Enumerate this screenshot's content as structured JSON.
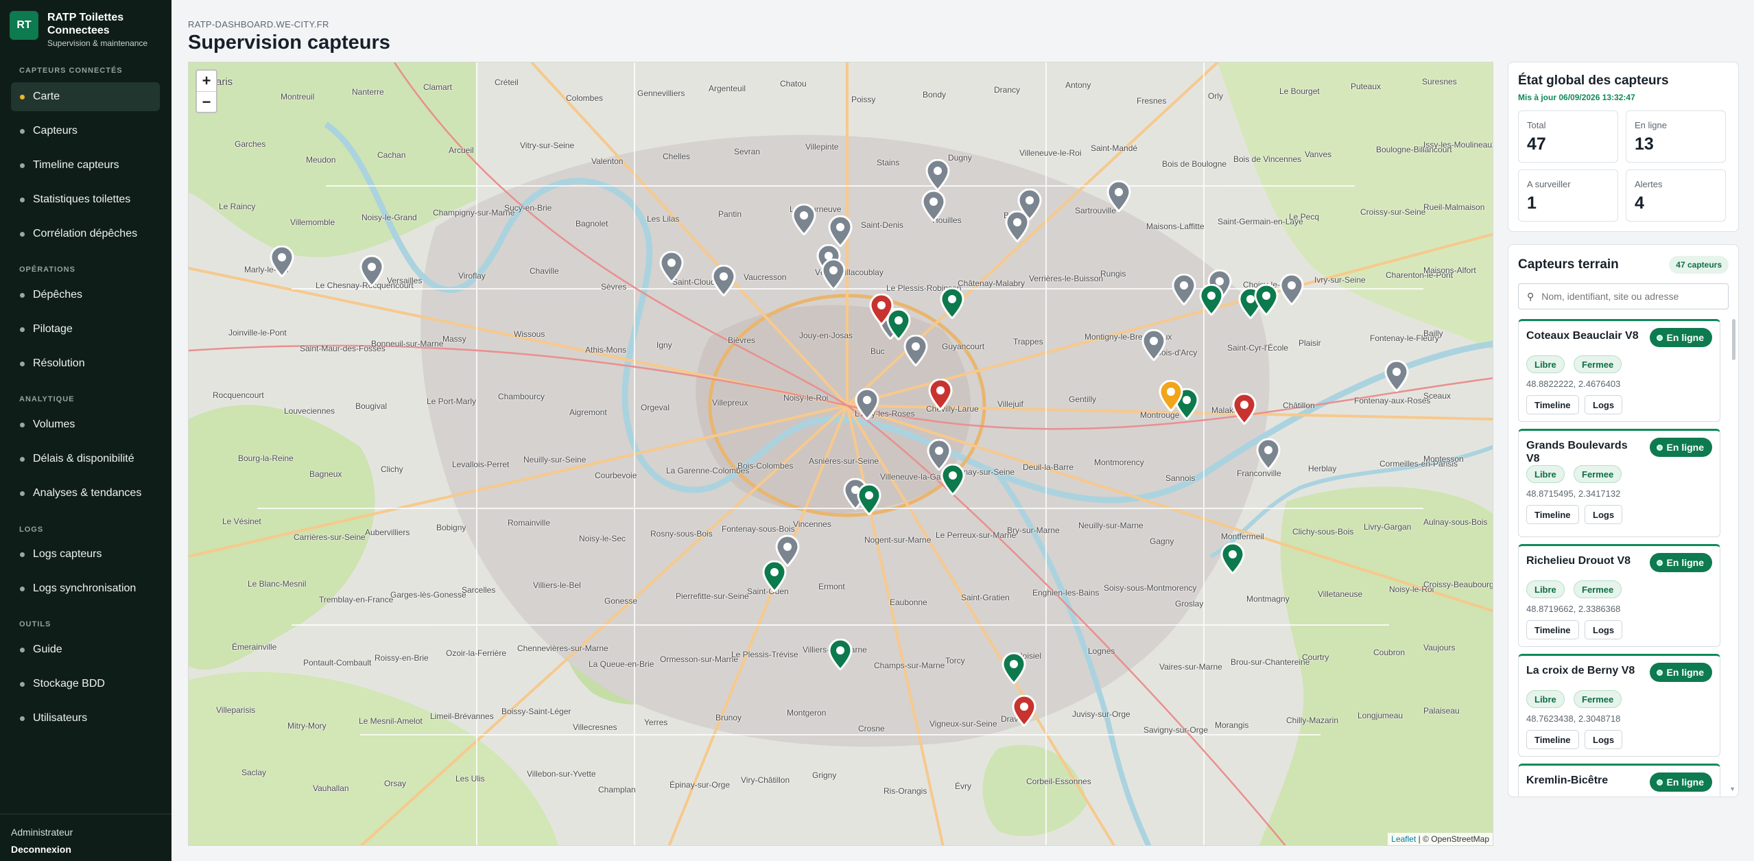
{
  "brand": {
    "logo": "RT",
    "title": "RATP Toilettes Connectees",
    "subtitle": "Supervision & maintenance"
  },
  "nav": {
    "sections": [
      {
        "label": "CAPTEURS CONNECTÉS",
        "items": [
          "Carte",
          "Capteurs",
          "Timeline capteurs",
          "Statistiques toilettes",
          "Corrélation dépêches"
        ]
      },
      {
        "label": "OPÉRATIONS",
        "items": [
          "Dépêches",
          "Pilotage",
          "Résolution"
        ]
      },
      {
        "label": "ANALYTIQUE",
        "items": [
          "Volumes",
          "Délais & disponibilité",
          "Analyses & tendances"
        ]
      },
      {
        "label": "LOGS",
        "items": [
          "Logs capteurs",
          "Logs synchronisation"
        ]
      },
      {
        "label": "OUTILS",
        "items": [
          "Guide",
          "Stockage BDD",
          "Utilisateurs"
        ]
      }
    ],
    "active": "Carte"
  },
  "footer": {
    "user": "Administrateur",
    "logout": "Deconnexion"
  },
  "header": {
    "domain": "RATP-DASHBOARD.WE-CITY.FR",
    "title": "Supervision capteurs"
  },
  "map": {
    "zoom_in": "+",
    "zoom_out": "−",
    "attribution": {
      "leaflet": "Leaflet",
      "osm": "| © OpenStreetMap"
    },
    "labels": [
      "Paris",
      "Montreuil",
      "Nanterre",
      "Clamart",
      "Créteil",
      "Colombes",
      "Gennevilliers",
      "Argenteuil",
      "Chatou",
      "Poissy",
      "Bondy",
      "Drancy",
      "Antony",
      "Fresnes",
      "Orly",
      "Le Bourget",
      "Puteaux",
      "Suresnes",
      "Garches",
      "Meudon",
      "Cachan",
      "Arcueil",
      "Vitry-sur-Seine",
      "Valenton",
      "Chelles",
      "Sevran",
      "Villepinte",
      "Stains",
      "Dugny",
      "Villeneuve-le-Roi",
      "Saint-Mandé",
      "Bois de Boulogne",
      "Bois de Vincennes",
      "Vanves",
      "Boulogne-Billancourt",
      "Issy-les-Moulineaux",
      "Le Raincy",
      "Villemomble",
      "Noisy-le-Grand",
      "Champigny-sur-Marne",
      "Sucy-en-Brie",
      "Bagnolet",
      "Les Lilas",
      "Pantin",
      "La Courneuve",
      "Saint-Denis",
      "Houilles",
      "Bezons",
      "Sartrouville",
      "Maisons-Laffitte",
      "Saint-Germain-en-Laye",
      "Le Pecq",
      "Croissy-sur-Seine",
      "Rueil-Malmaison",
      "Marly-le-Roi",
      "Le Chesnay-Rocquencourt",
      "Versailles",
      "Viroflay",
      "Chaville",
      "Sèvres",
      "Saint-Cloud",
      "Vaucresson",
      "Vélizy-Villacoublay",
      "Le Plessis-Robinson",
      "Châtenay-Malabry",
      "Verrières-le-Buisson",
      "Rungis",
      "Thiais",
      "Choisy-le-Roi",
      "Ivry-sur-Seine",
      "Charenton-le-Pont",
      "Maisons-Alfort",
      "Joinville-le-Pont",
      "Saint-Maur-des-Fossés",
      "Bonneuil-sur-Marne",
      "Massy",
      "Wissous",
      "Athis-Mons",
      "Igny",
      "Bièvres",
      "Jouy-en-Josas",
      "Buc",
      "Guyancourt",
      "Trappes",
      "Montigny-le-Bretonneux",
      "Bois-d'Arcy",
      "Saint-Cyr-l'École",
      "Plaisir",
      "Fontenay-le-Fleury",
      "Bailly",
      "Rocquencourt",
      "Louveciennes",
      "Bougival",
      "Le Port-Marly",
      "Chambourcy",
      "Aigremont",
      "Orgeval",
      "Villepreux",
      "Noisy-le-Roi",
      "L'Haÿ-les-Roses",
      "Chevilly-Larue",
      "Villejuif",
      "Gentilly",
      "Montrouge",
      "Malakoff",
      "Châtillon",
      "Fontenay-aux-Roses",
      "Sceaux",
      "Bourg-la-Reine",
      "Bagneux",
      "Clichy",
      "Levallois-Perret",
      "Neuilly-sur-Seine",
      "Courbevoie",
      "La Garenne-Colombes",
      "Bois-Colombes",
      "Asnières-sur-Seine",
      "Villeneuve-la-Garenne",
      "Épinay-sur-Seine",
      "Deuil-la-Barre",
      "Montmorency",
      "Sannois",
      "Franconville",
      "Herblay",
      "Cormeilles-en-Parisis",
      "Montesson",
      "Le Vésinet",
      "Carrières-sur-Seine",
      "Aubervilliers",
      "Bobigny",
      "Romainville",
      "Noisy-le-Sec",
      "Rosny-sous-Bois",
      "Fontenay-sous-Bois",
      "Vincennes",
      "Nogent-sur-Marne",
      "Le Perreux-sur-Marne",
      "Bry-sur-Marne",
      "Neuilly-sur-Marne",
      "Gagny",
      "Montfermeil",
      "Clichy-sous-Bois",
      "Livry-Gargan",
      "Aulnay-sous-Bois",
      "Le Blanc-Mesnil",
      "Tremblay-en-France",
      "Garges-lès-Gonesse",
      "Sarcelles",
      "Villiers-le-Bel",
      "Gonesse",
      "Pierrefitte-sur-Seine",
      "Saint-Ouen",
      "Ermont",
      "Eaubonne",
      "Saint-Gratien",
      "Enghien-les-Bains",
      "Soisy-sous-Montmorency",
      "Groslay",
      "Montmagny",
      "Villetaneuse",
      "Noisy-le-Roi",
      "Croissy-Beaubourg",
      "Émerainville",
      "Pontault-Combault",
      "Roissy-en-Brie",
      "Ozoir-la-Ferrière",
      "Chennevières-sur-Marne",
      "La Queue-en-Brie",
      "Ormesson-sur-Marne",
      "Le Plessis-Trévise",
      "Villiers-sur-Marne",
      "Champs-sur-Marne",
      "Torcy",
      "Noisiel",
      "Lognes",
      "Vaires-sur-Marne",
      "Brou-sur-Chantereine",
      "Courtry",
      "Coubron",
      "Vaujours",
      "Villeparisis",
      "Mitry-Mory",
      "Le Mesnil-Amelot",
      "Limeil-Brévannes",
      "Boissy-Saint-Léger",
      "Villecresnes",
      "Yerres",
      "Brunoy",
      "Montgeron",
      "Crosne",
      "Vigneux-sur-Seine",
      "Draveil",
      "Juvisy-sur-Orge",
      "Savigny-sur-Orge",
      "Morangis",
      "Chilly-Mazarin",
      "Longjumeau",
      "Palaiseau",
      "Saclay",
      "Vauhallan",
      "Orsay",
      "Les Ulis",
      "Villebon-sur-Yvette",
      "Champlan",
      "Épinay-sur-Orge",
      "Viry-Châtillon",
      "Grigny",
      "Ris-Orangis",
      "Évry",
      "Corbeil-Essonnes"
    ]
  },
  "stats": {
    "title": "État global des capteurs",
    "updated": "Mis à jour 06/09/2026 13:32:47",
    "items": [
      {
        "label": "Total",
        "value": "47"
      },
      {
        "label": "En ligne",
        "value": "13"
      },
      {
        "label": "A surveiller",
        "value": "1"
      },
      {
        "label": "Alertes",
        "value": "4"
      }
    ]
  },
  "sensors": {
    "title": "Capteurs terrain",
    "count": "47 capteurs",
    "search_placeholder": "Nom, identifiant, site ou adresse",
    "status_label": "En ligne",
    "chip_free": "Libre",
    "chip_closed": "Fermee",
    "btn_timeline": "Timeline",
    "btn_logs": "Logs",
    "items": [
      {
        "name": "Coteaux Beauclair V8",
        "coords": "48.8822222, 2.4676403"
      },
      {
        "name": "Grands Boulevards V8",
        "coords": "48.8715495, 2.3417132"
      },
      {
        "name": "Richelieu Drouot V8",
        "coords": "48.8719662, 2.3386368"
      },
      {
        "name": "La croix de Berny V8",
        "coords": "48.7623438, 2.3048718"
      },
      {
        "name": "Kremlin-Bicêtre",
        "coords": ""
      }
    ]
  },
  "markers": {
    "colors": {
      "grey": "#7b8590",
      "green": "#0c7a4c",
      "red": "#c8332f",
      "orange": "#f0a51b"
    },
    "points": [
      {
        "lat": 48.9362,
        "lon": 2.3574,
        "status": "grey"
      },
      {
        "lat": 48.8989,
        "lon": 2.0936,
        "status": "grey"
      },
      {
        "lat": 48.8946,
        "lon": 2.1298,
        "status": "grey"
      },
      {
        "lat": 48.8965,
        "lon": 2.2505,
        "status": "grey"
      },
      {
        "lat": 48.8904,
        "lon": 2.2713,
        "status": "grey"
      },
      {
        "lat": 48.9169,
        "lon": 2.3037,
        "status": "grey"
      },
      {
        "lat": 48.912,
        "lon": 2.3183,
        "status": "grey"
      },
      {
        "lat": 48.923,
        "lon": 2.356,
        "status": "grey"
      },
      {
        "lat": 48.8995,
        "lon": 2.3137,
        "status": "grey"
      },
      {
        "lat": 48.8933,
        "lon": 2.3157,
        "status": "grey"
      },
      {
        "lat": 48.9235,
        "lon": 2.3945,
        "status": "grey"
      },
      {
        "lat": 48.9139,
        "lon": 2.3894,
        "status": "grey"
      },
      {
        "lat": 48.927,
        "lon": 2.4303,
        "status": "grey"
      },
      {
        "lat": 48.8866,
        "lon": 2.4565,
        "status": "grey"
      },
      {
        "lat": 48.8883,
        "lon": 2.4708,
        "status": "grey"
      },
      {
        "lat": 48.8867,
        "lon": 2.5,
        "status": "grey"
      },
      {
        "lat": 48.8627,
        "lon": 2.4443,
        "status": "grey"
      },
      {
        "lat": 48.8492,
        "lon": 2.5422,
        "status": "grey"
      },
      {
        "lat": 48.8717,
        "lon": 2.3416,
        "status": "grey"
      },
      {
        "lat": 48.8601,
        "lon": 2.3486,
        "status": "grey"
      },
      {
        "lat": 48.837,
        "lon": 2.329,
        "status": "grey"
      },
      {
        "lat": 48.815,
        "lon": 2.358,
        "status": "grey"
      },
      {
        "lat": 48.8153,
        "lon": 2.4905,
        "status": "grey"
      },
      {
        "lat": 48.798,
        "lon": 2.3245,
        "status": "grey"
      },
      {
        "lat": 48.7733,
        "lon": 2.297,
        "status": "grey"
      },
      {
        "lat": 48.8719,
        "lon": 2.3386,
        "status": "grey"
      },
      {
        "lat": 48.8822,
        "lon": 2.4676,
        "status": "green"
      },
      {
        "lat": 48.8808,
        "lon": 2.4833,
        "status": "green"
      },
      {
        "lat": 48.8823,
        "lon": 2.4897,
        "status": "green"
      },
      {
        "lat": 48.8808,
        "lon": 2.3632,
        "status": "green"
      },
      {
        "lat": 48.8715,
        "lon": 2.3417,
        "status": "green"
      },
      {
        "lat": 48.837,
        "lon": 2.4578,
        "status": "green"
      },
      {
        "lat": 48.8043,
        "lon": 2.3636,
        "status": "green"
      },
      {
        "lat": 48.7957,
        "lon": 2.33,
        "status": "green"
      },
      {
        "lat": 48.77,
        "lon": 2.4762,
        "status": "green"
      },
      {
        "lat": 48.7623,
        "lon": 2.2919,
        "status": "green"
      },
      {
        "lat": 48.7284,
        "lon": 2.3183,
        "status": "green"
      },
      {
        "lat": 48.7226,
        "lon": 2.3882,
        "status": "green"
      },
      {
        "lat": 48.8781,
        "lon": 2.335,
        "status": "red"
      },
      {
        "lat": 48.8412,
        "lon": 2.3585,
        "status": "red"
      },
      {
        "lat": 48.8348,
        "lon": 2.4809,
        "status": "red"
      },
      {
        "lat": 48.7041,
        "lon": 2.3922,
        "status": "red"
      },
      {
        "lat": 48.8407,
        "lon": 2.4513,
        "status": "orange"
      }
    ]
  }
}
